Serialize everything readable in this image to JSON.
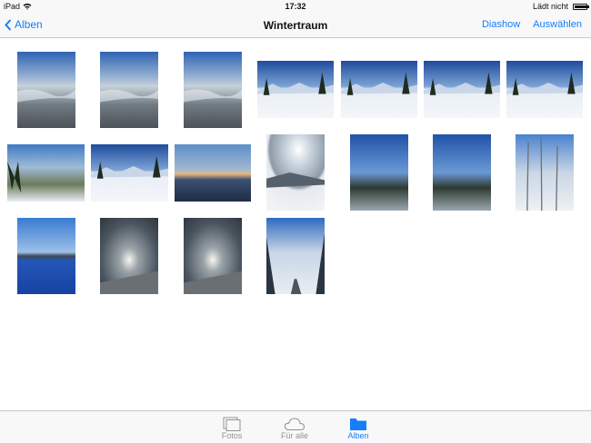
{
  "status_bar": {
    "device": "iPad",
    "time": "17:32",
    "charging": "Lädt nicht",
    "battery_level": 0.9
  },
  "nav": {
    "back_label": "Alben",
    "title": "Wintertraum",
    "slideshow_label": "Diashow",
    "select_label": "Auswählen"
  },
  "photos": [
    {
      "name": "photo-aerial-clouds-1",
      "kind": "aerial"
    },
    {
      "name": "photo-aerial-wing",
      "kind": "aerial"
    },
    {
      "name": "photo-aerial-clouds-2",
      "kind": "aerial"
    },
    {
      "name": "photo-snow-trees-mountains",
      "kind": "snow"
    },
    {
      "name": "photo-snow-field-mountains",
      "kind": "snow"
    },
    {
      "name": "photo-snow-tracks",
      "kind": "snow"
    },
    {
      "name": "photo-snow-hut",
      "kind": "snow"
    },
    {
      "name": "photo-valley-view",
      "kind": "valley"
    },
    {
      "name": "photo-snow-slope-trees",
      "kind": "snow"
    },
    {
      "name": "photo-sunset-mountains",
      "kind": "sunset"
    },
    {
      "name": "photo-sun-snow-slope",
      "kind": "sunhaze"
    },
    {
      "name": "photo-trees-fence",
      "kind": "forest"
    },
    {
      "name": "photo-dark-forest",
      "kind": "forest"
    },
    {
      "name": "photo-birch-trees",
      "kind": "birch"
    },
    {
      "name": "photo-blue-lake",
      "kind": "lake"
    },
    {
      "name": "photo-sun-clouds",
      "kind": "clouds"
    },
    {
      "name": "photo-dramatic-clouds",
      "kind": "clouds"
    },
    {
      "name": "photo-snowy-road",
      "kind": "road"
    }
  ],
  "tabs": [
    {
      "name": "tab-fotos",
      "label": "Fotos",
      "icon": "photos-icon",
      "active": false
    },
    {
      "name": "tab-fuer-alle",
      "label": "Für alle",
      "icon": "cloud-icon",
      "active": false
    },
    {
      "name": "tab-alben",
      "label": "Alben",
      "icon": "folder-icon",
      "active": true
    }
  ],
  "colors": {
    "accent": "#157efb",
    "inactive": "#929292"
  }
}
